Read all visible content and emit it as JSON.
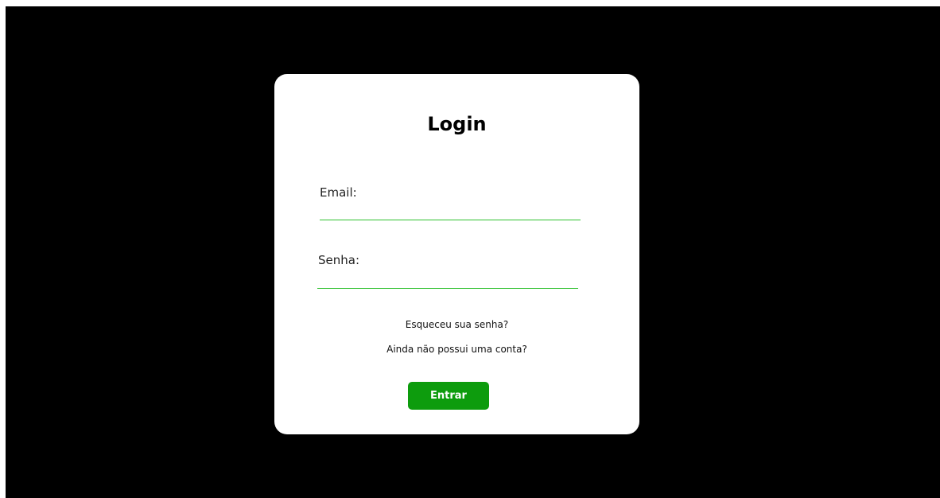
{
  "login": {
    "title": "Login",
    "email_label": "Email:",
    "email_value": "",
    "password_label": "Senha:",
    "password_value": "",
    "forgot_password_link": "Esqueceu sua senha?",
    "signup_link": "Ainda não possui uma conta?",
    "submit_label": "Entrar"
  },
  "colors": {
    "background": "#000000",
    "card": "#ffffff",
    "accent_line": "#2ec02e",
    "button": "#0d9c0d",
    "button_text": "#ffffff"
  }
}
